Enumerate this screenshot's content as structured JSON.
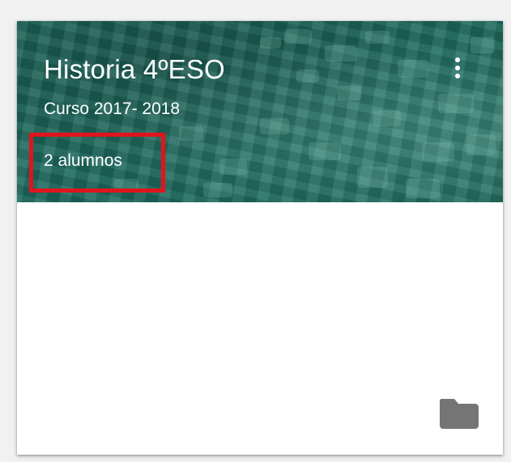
{
  "class_card": {
    "title": "Historia 4ºESO",
    "section": "Curso 2017- 2018",
    "student_count": "2 alumnos"
  },
  "icons": {
    "more": "more-vert-icon",
    "folder": "folder-icon"
  },
  "colors": {
    "header_theme": "#1e6a5e",
    "highlight": "#e0141c",
    "icon_gray": "#757575"
  }
}
